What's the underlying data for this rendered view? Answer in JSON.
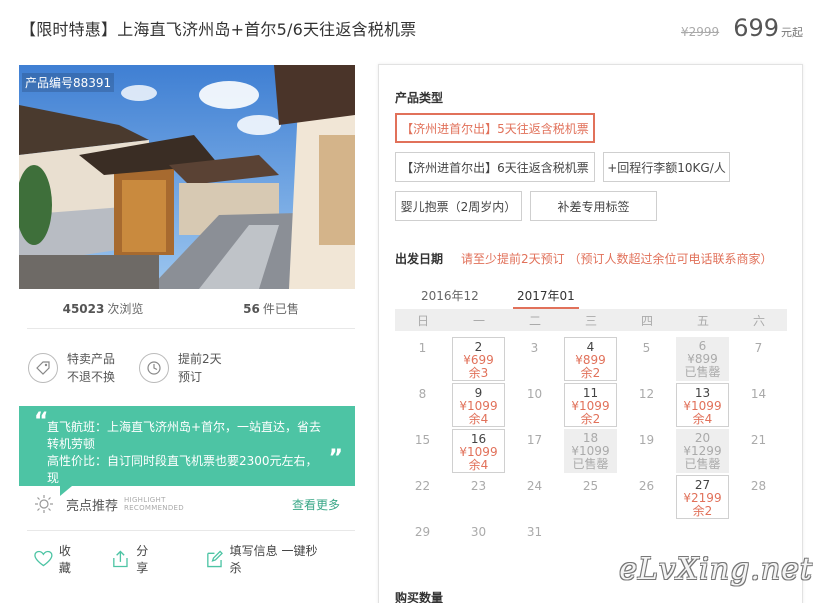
{
  "header": {
    "title": "【限时特惠】上海直飞济州岛+首尔5/6天往返含税机票",
    "old_price": "¥2999",
    "price": "699",
    "price_suffix": "元起"
  },
  "product": {
    "id_label": "产品编号88391",
    "views_count": "45023",
    "views_label": "次浏览",
    "sold_count": "56",
    "sold_label": "件已售"
  },
  "features": [
    {
      "icon": "tag-icon",
      "line1": "特卖产品",
      "line2": "不退不换"
    },
    {
      "icon": "clock-icon",
      "line1": "提前2天",
      "line2": "预订"
    }
  ],
  "highlight": {
    "line1": "直飞航班：上海直飞济州岛+首尔，一站直达，省去",
    "line2": "转机劳顿",
    "line3": "高性价比：自订同时段直飞机票也要2300元左右，现"
  },
  "recommend": {
    "label": "亮点推荐",
    "en_line1": "HIGHLIGHT",
    "en_line2": "RECOMMENDED",
    "more": "查看更多"
  },
  "actions": {
    "favorite": "收藏",
    "share": "分享",
    "fill_info": "填写信息 一键秒杀"
  },
  "product_type": {
    "title": "产品类型",
    "options": [
      "【济州进首尔出】5天往返含税机票",
      "【济州进首尔出】6天往返含税机票",
      "+回程行李额10KG/人",
      "婴儿抱票（2周岁内）",
      "补差专用标签"
    ]
  },
  "departure": {
    "title": "出发日期",
    "note": "请至少提前2天预订 （预订人数超过余位可电话联系商家）",
    "months": [
      "2016年12",
      "2017年01"
    ],
    "weekdays": [
      "日",
      "一",
      "二",
      "三",
      "四",
      "五",
      "六"
    ],
    "rows": [
      [
        {
          "d": "1"
        },
        {
          "d": "2",
          "p": "¥699",
          "s": "余3"
        },
        {
          "d": "3"
        },
        {
          "d": "4",
          "p": "¥899",
          "s": "余2"
        },
        {
          "d": "5"
        },
        {
          "d": "6",
          "p": "¥899",
          "s": "已售罄",
          "sold": true
        },
        {
          "d": "7"
        }
      ],
      [
        {
          "d": "8"
        },
        {
          "d": "9",
          "p": "¥1099",
          "s": "余4"
        },
        {
          "d": "10"
        },
        {
          "d": "11",
          "p": "¥1099",
          "s": "余2"
        },
        {
          "d": "12"
        },
        {
          "d": "13",
          "p": "¥1099",
          "s": "余4"
        },
        {
          "d": "14"
        }
      ],
      [
        {
          "d": "15"
        },
        {
          "d": "16",
          "p": "¥1099",
          "s": "余4"
        },
        {
          "d": "17"
        },
        {
          "d": "18",
          "p": "¥1099",
          "s": "已售罄",
          "sold": true
        },
        {
          "d": "19"
        },
        {
          "d": "20",
          "p": "¥1299",
          "s": "已售罄",
          "sold": true
        },
        {
          "d": "21"
        }
      ],
      [
        {
          "d": "22"
        },
        {
          "d": "23"
        },
        {
          "d": "24"
        },
        {
          "d": "25"
        },
        {
          "d": "26"
        },
        {
          "d": "27",
          "p": "¥2199",
          "s": "余2"
        },
        {
          "d": "28"
        }
      ],
      [
        {
          "d": "29"
        },
        {
          "d": "30"
        },
        {
          "d": "31"
        }
      ]
    ]
  },
  "purchase": {
    "title": "购买数量"
  },
  "watermark": "eLvXing.net"
}
